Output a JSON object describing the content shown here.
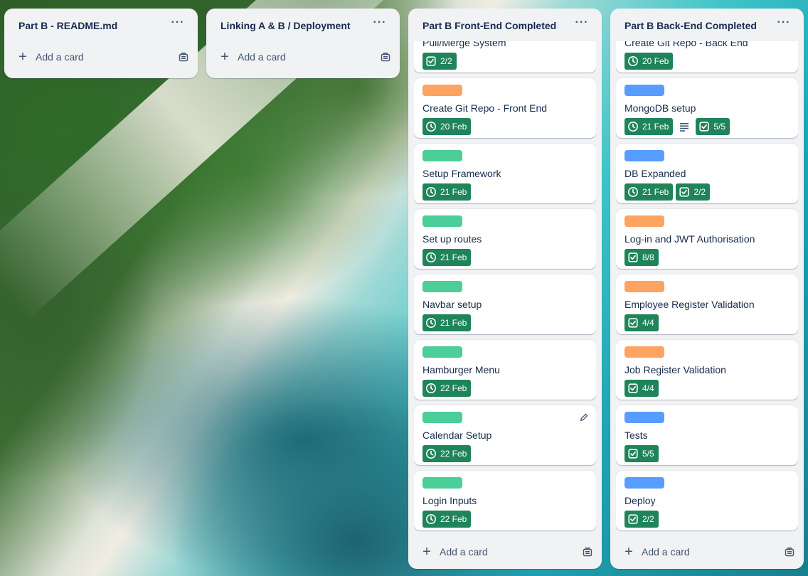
{
  "colors": {
    "label_orange": "#fea362",
    "label_green": "#4bce97",
    "label_blue": "#579dff",
    "badge_green": "#1f845a"
  },
  "lists": [
    {
      "title": "Part B - README.md",
      "add_card": "Add a card"
    },
    {
      "title": "Linking A & B / Deployment",
      "add_card": "Add a card"
    },
    {
      "title": "Part B Front-End Completed",
      "add_card": "Add a card",
      "cards": [
        {
          "title": "Pull/Merge System",
          "label": null,
          "badges": [
            {
              "type": "checklist",
              "text": "2/2"
            }
          ]
        },
        {
          "title": "Create Git Repo - Front End",
          "label": "orange",
          "badges": [
            {
              "type": "date",
              "text": "20 Feb"
            }
          ]
        },
        {
          "title": "Setup Framework",
          "label": "green",
          "badges": [
            {
              "type": "date",
              "text": "21 Feb"
            }
          ]
        },
        {
          "title": "Set up routes",
          "label": "green",
          "badges": [
            {
              "type": "date",
              "text": "21 Feb"
            }
          ]
        },
        {
          "title": "Navbar setup",
          "label": "green",
          "badges": [
            {
              "type": "date",
              "text": "21 Feb"
            }
          ]
        },
        {
          "title": "Hamburger Menu",
          "label": "green",
          "badges": [
            {
              "type": "date",
              "text": "22 Feb"
            }
          ]
        },
        {
          "title": "Calendar Setup",
          "label": "green",
          "badges": [
            {
              "type": "date",
              "text": "22 Feb"
            }
          ],
          "edit_icon": "pencil-icon"
        },
        {
          "title": "Login Inputs",
          "label": "green",
          "badges": [
            {
              "type": "date",
              "text": "22 Feb"
            }
          ]
        }
      ]
    },
    {
      "title": "Part B Back-End Completed",
      "add_card": "Add a card",
      "cards": [
        {
          "title": "Create Git Repo - Back End",
          "label": null,
          "badges": [
            {
              "type": "date",
              "text": "20 Feb"
            }
          ]
        },
        {
          "title": "MongoDB setup",
          "label": "blue",
          "badges": [
            {
              "type": "date",
              "text": "21 Feb"
            },
            {
              "type": "description"
            },
            {
              "type": "checklist",
              "text": "5/5"
            }
          ]
        },
        {
          "title": "DB Expanded",
          "label": "blue",
          "badges": [
            {
              "type": "date",
              "text": "21 Feb"
            },
            {
              "type": "checklist",
              "text": "2/2"
            }
          ]
        },
        {
          "title": "Log-in and JWT Authorisation",
          "label": "orange",
          "badges": [
            {
              "type": "checklist",
              "text": "8/8"
            }
          ]
        },
        {
          "title": "Employee Register Validation",
          "label": "orange",
          "badges": [
            {
              "type": "checklist",
              "text": "4/4"
            }
          ]
        },
        {
          "title": "Job Register Validation",
          "label": "orange",
          "badges": [
            {
              "type": "checklist",
              "text": "4/4"
            }
          ]
        },
        {
          "title": "Tests",
          "label": "blue",
          "badges": [
            {
              "type": "checklist",
              "text": "5/5"
            }
          ]
        },
        {
          "title": "Deploy",
          "label": "blue",
          "badges": [
            {
              "type": "checklist",
              "text": "2/2"
            }
          ]
        }
      ]
    }
  ]
}
